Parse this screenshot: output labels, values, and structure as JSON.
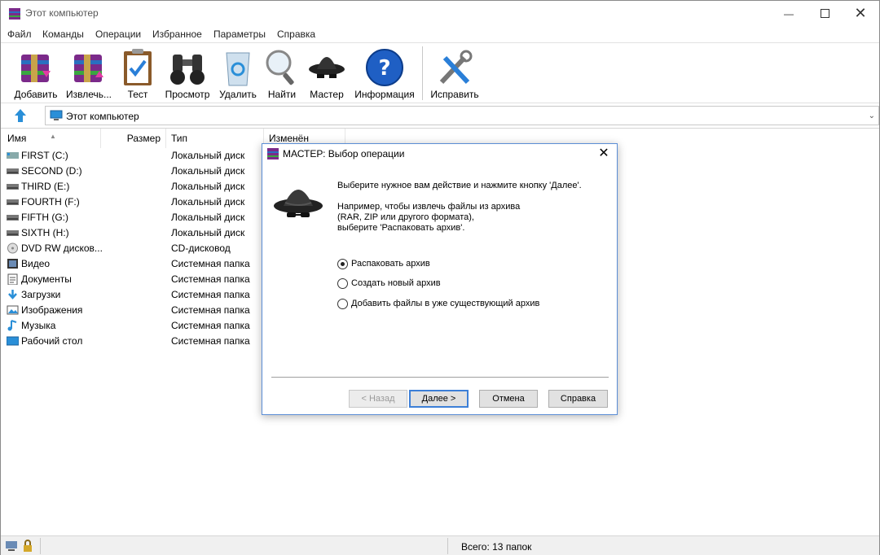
{
  "window": {
    "title": "Этот компьютер"
  },
  "menu": [
    "Файл",
    "Команды",
    "Операции",
    "Избранное",
    "Параметры",
    "Справка"
  ],
  "toolbar": [
    {
      "label": "Добавить",
      "icon": "archive-add-icon"
    },
    {
      "label": "Извлечь...",
      "icon": "archive-extract-icon"
    },
    {
      "label": "Тест",
      "icon": "clipboard-check-icon"
    },
    {
      "label": "Просмотр",
      "icon": "binoculars-icon"
    },
    {
      "label": "Удалить",
      "icon": "recycle-bin-icon"
    },
    {
      "label": "Найти",
      "icon": "magnifier-icon"
    },
    {
      "label": "Мастер",
      "icon": "wizard-hat-icon"
    },
    {
      "label": "Информация",
      "icon": "info-icon"
    },
    {
      "label": "Исправить",
      "icon": "repair-tools-icon"
    }
  ],
  "address": {
    "path": "Этот компьютер"
  },
  "columns": [
    "Имя",
    "Размер",
    "Тип",
    "Изменён"
  ],
  "rows": [
    {
      "name": "FIRST (C:)",
      "type": "Локальный диск",
      "icon": "system-drive-icon"
    },
    {
      "name": "SECOND (D:)",
      "type": "Локальный диск",
      "icon": "drive-icon"
    },
    {
      "name": "THIRD (E:)",
      "type": "Локальный диск",
      "icon": "drive-icon"
    },
    {
      "name": "FOURTH (F:)",
      "type": "Локальный диск",
      "icon": "drive-icon"
    },
    {
      "name": "FIFTH (G:)",
      "type": "Локальный диск",
      "icon": "drive-icon"
    },
    {
      "name": "SIXTH (H:)",
      "type": "Локальный диск",
      "icon": "drive-icon"
    },
    {
      "name": "DVD RW дисков...",
      "type": "CD-дисковод",
      "icon": "dvd-drive-icon"
    },
    {
      "name": "Видео",
      "type": "Системная папка",
      "icon": "video-folder-icon"
    },
    {
      "name": "Документы",
      "type": "Системная папка",
      "icon": "documents-folder-icon"
    },
    {
      "name": "Загрузки",
      "type": "Системная папка",
      "icon": "downloads-folder-icon"
    },
    {
      "name": "Изображения",
      "type": "Системная папка",
      "icon": "pictures-folder-icon"
    },
    {
      "name": "Музыка",
      "type": "Системная папка",
      "icon": "music-folder-icon"
    },
    {
      "name": "Рабочий стол",
      "type": "Системная папка",
      "icon": "desktop-folder-icon"
    }
  ],
  "status": {
    "text": "Всего: 13 папок"
  },
  "dialog": {
    "title": "МАСТЕР:  Выбор операции",
    "intro": "Выберите нужное вам действие и нажмите кнопку 'Далее'.",
    "example_line1": "Например, чтобы извлечь файлы из архива",
    "example_line2": "(RAR, ZIP или другого формата),",
    "example_line3": "выберите 'Распаковать архив'.",
    "options": [
      {
        "label": "Распаковать архив",
        "checked": true
      },
      {
        "label": "Создать новый архив",
        "checked": false
      },
      {
        "label": "Добавить файлы в уже существующий архив",
        "checked": false
      }
    ],
    "buttons": {
      "back": "< Назад",
      "next": "Далее >",
      "cancel": "Отмена",
      "help": "Справка"
    }
  },
  "colors": {
    "accent": "#3c7fd7",
    "selection": "#cce8ff"
  }
}
